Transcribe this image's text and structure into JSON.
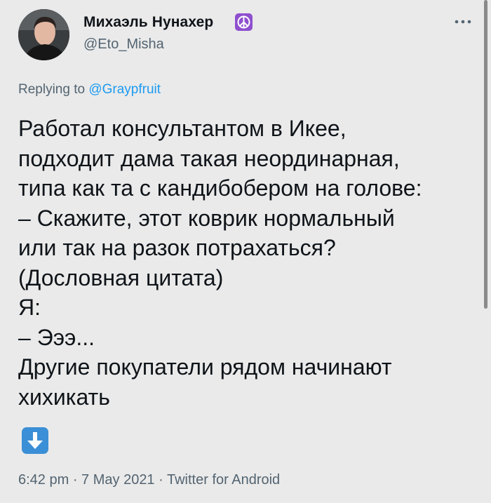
{
  "author": {
    "display_name": "Михаэль Нунахер",
    "badge_icon": "peace-sign-icon",
    "username": "@Eto_Misha"
  },
  "reply": {
    "prefix": "Replying to ",
    "handle": "@Graypfruit"
  },
  "tweet": {
    "lines": [
      "Работал консультантом в Икее,",
      "подходит дама такая неординарная,",
      "типа как та с кандибобером на голове:",
      "– Скажите, этот коврик нормальный",
      "или так на разок потрахаться?",
      "(Дословная цитата)",
      "Я:",
      "– Эээ...",
      "Другие покупатели рядом начинают",
      "хихикать"
    ],
    "emoji_icon": "down-arrow-icon"
  },
  "meta": {
    "time": "6:42 pm",
    "sep1": " · ",
    "date": "7 May 2021",
    "sep2": " · ",
    "source": "Twitter for Android"
  },
  "colors": {
    "background": "#eaeaea",
    "text": "#0f1419",
    "secondary": "#536471",
    "link": "#1d9bf0",
    "badge": "#8e4fcf",
    "emoji": "#3b8fd6"
  }
}
